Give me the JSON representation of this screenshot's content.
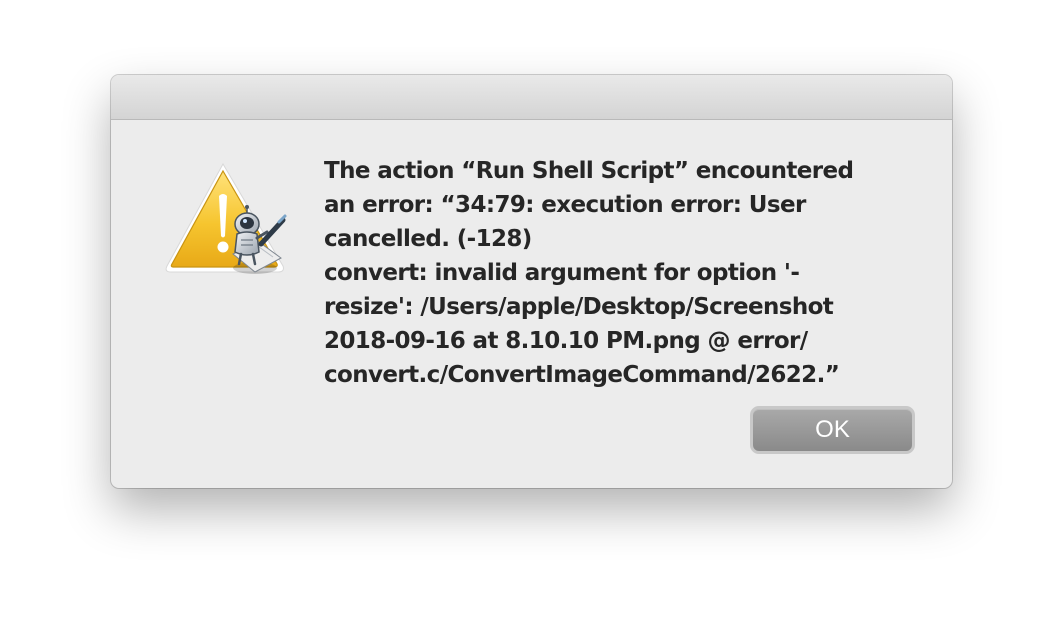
{
  "dialog": {
    "message": "The action “Run Shell Script” encountered\nan error: “34:79: execution error: User\ncancelled. (-128)\nconvert: invalid argument for option '-\nresize': /Users/apple/Desktop/Screenshot\n2018-09-16 at 8.10.10 PM.png @ error/\nconvert.c/ConvertImageCommand/2622.”",
    "ok_label": "OK",
    "icon": "warning-icon-with-automator-robot-badge"
  },
  "colors": {
    "dialog_background": "#ececec",
    "warning_yellow": "#f4c22b",
    "button_gray": "#999999",
    "text": "#262626"
  }
}
